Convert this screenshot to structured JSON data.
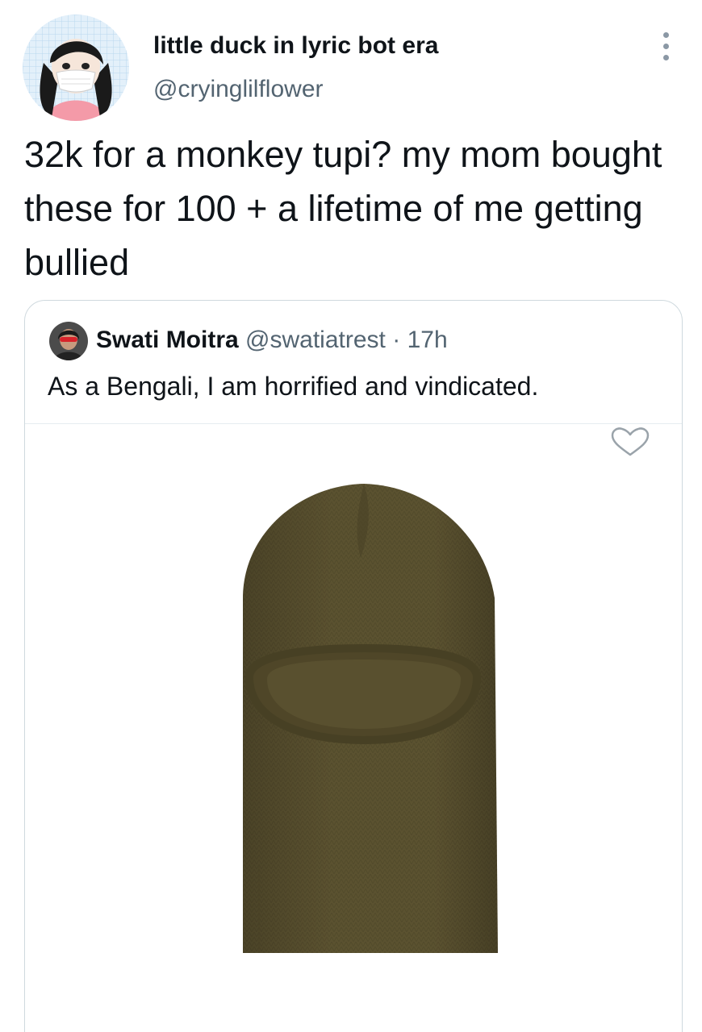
{
  "tweet": {
    "author": {
      "display_name": "little duck in lyric bot era",
      "handle": "@cryinglilflower"
    },
    "text": "32k for a monkey tupi? my mom bought these for 100 + a lifetime of me getting bullied",
    "more_icon": "more-horizontal-icon"
  },
  "quote": {
    "author": {
      "display_name": "Swati Moitra",
      "handle": "@swatiatrest"
    },
    "separator": "·",
    "time": "17h",
    "text": "As a Bengali, I am horrified and vindicated.",
    "media": {
      "heart_icon": "heart-outline-icon",
      "colors": {
        "balaclava": "#5b5230",
        "balaclava_shadow": "#4a4226"
      }
    }
  }
}
